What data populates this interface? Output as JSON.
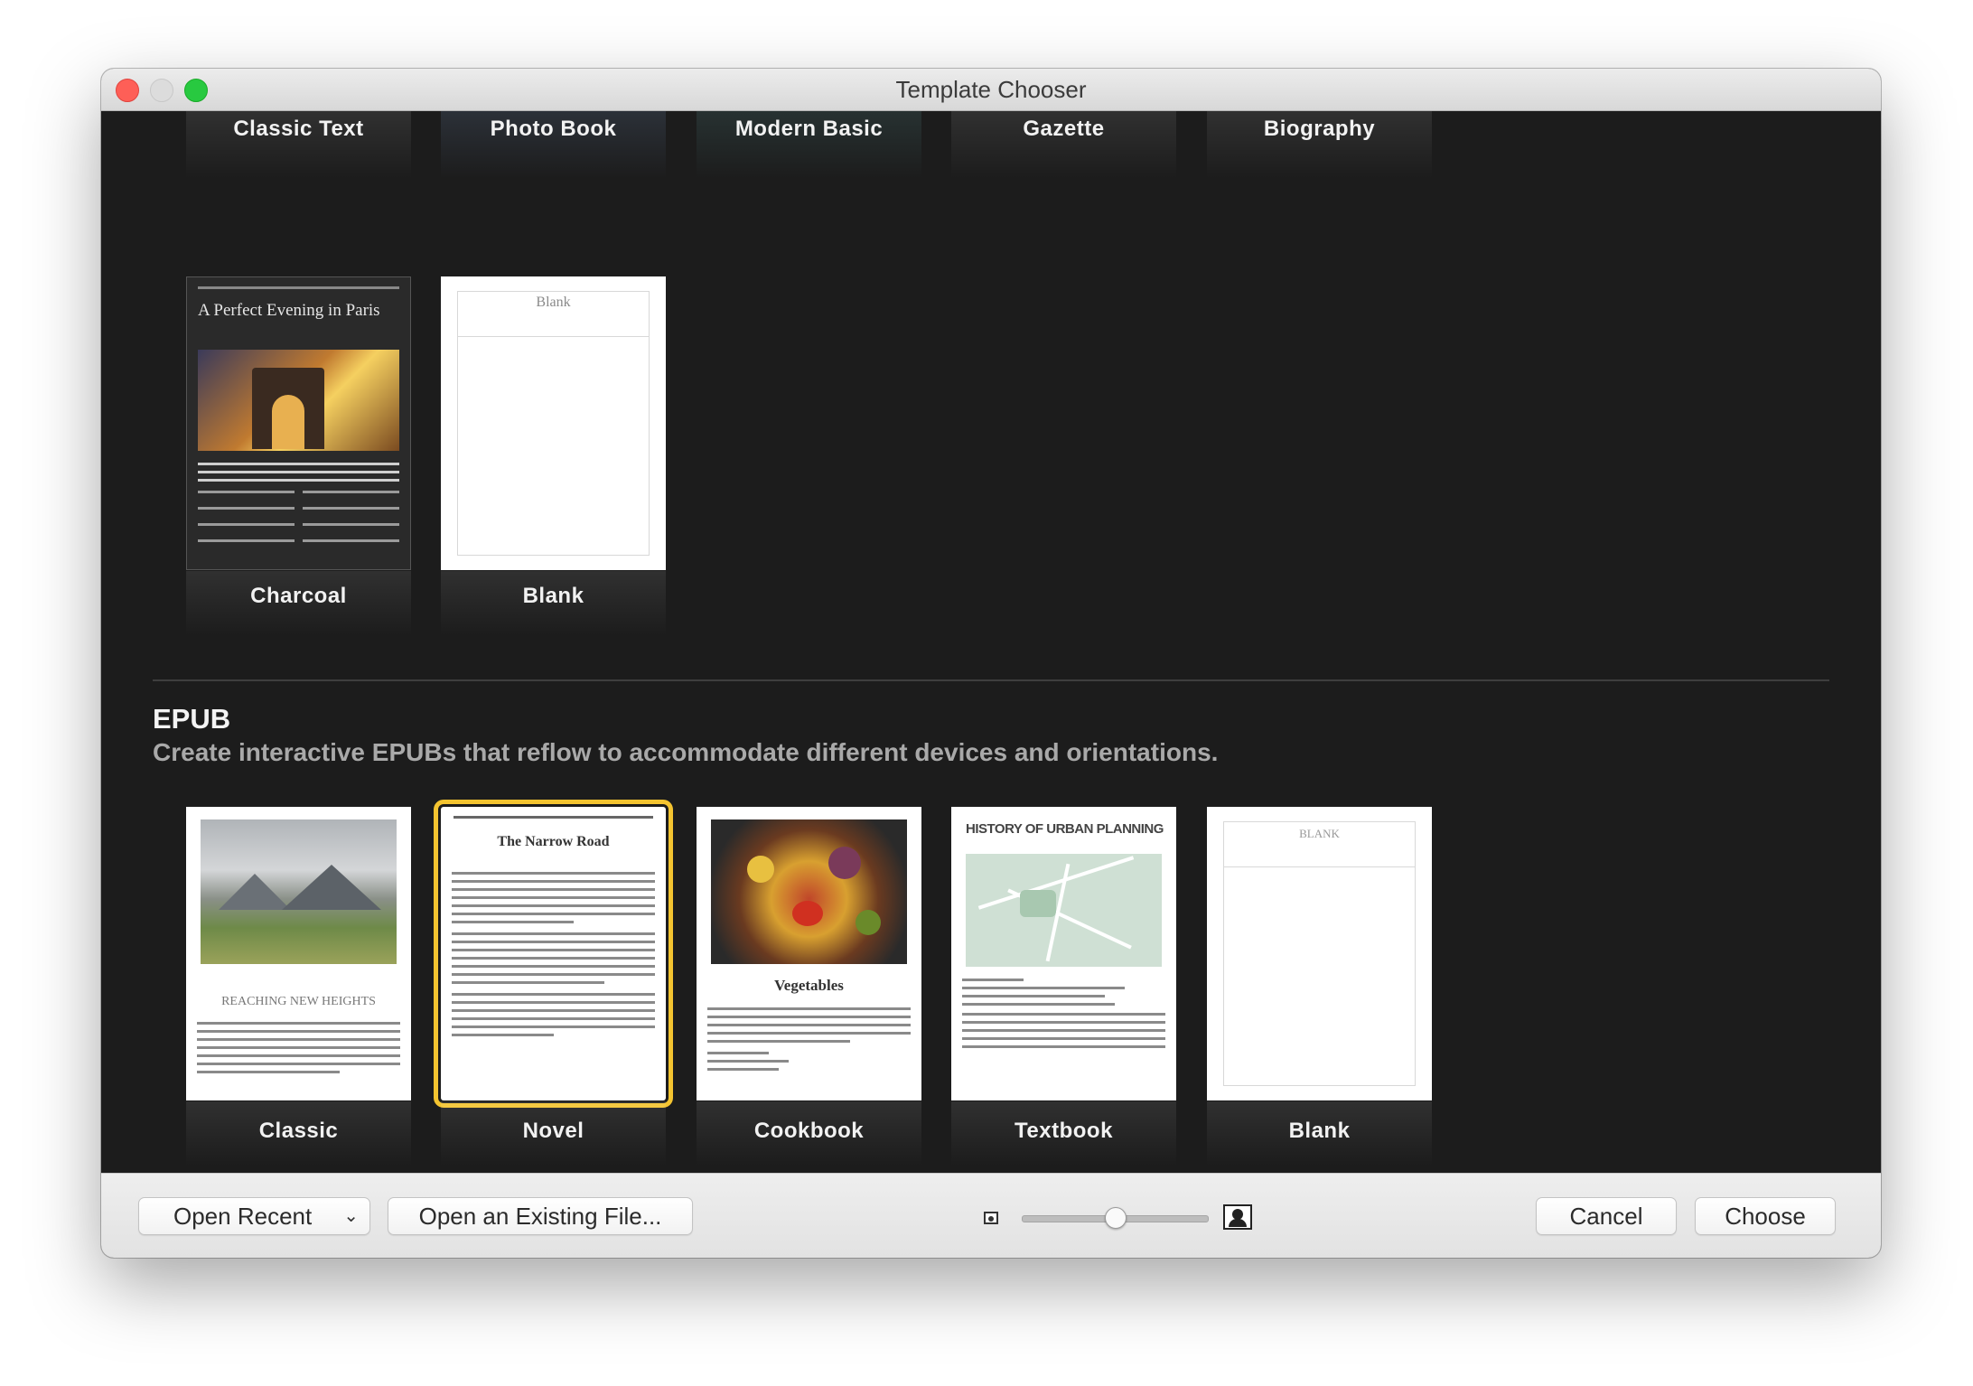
{
  "window": {
    "title": "Template Chooser"
  },
  "top_row": [
    {
      "label": "Classic Text"
    },
    {
      "label": "Photo Book"
    },
    {
      "label": "Modern Basic"
    },
    {
      "label": "Gazette"
    },
    {
      "label": "Biography"
    }
  ],
  "second_row": [
    {
      "label": "Charcoal",
      "preview_title": "A Perfect Evening in Paris"
    },
    {
      "label": "Blank",
      "preview_title": "Blank"
    }
  ],
  "epub": {
    "title": "EPUB",
    "subtitle": "Create interactive EPUBs that reflow to accommodate different devices and orientations.",
    "templates": [
      {
        "label": "Classic",
        "preview_title": "REACHING NEW HEIGHTS"
      },
      {
        "label": "Novel",
        "preview_title": "The Narrow Road",
        "selected": true
      },
      {
        "label": "Cookbook",
        "preview_title": "Vegetables"
      },
      {
        "label": "Textbook",
        "preview_title": "HISTORY OF URBAN PLANNING"
      },
      {
        "label": "Blank",
        "preview_title": "BLANK"
      }
    ]
  },
  "footer": {
    "open_recent": "Open Recent",
    "open_existing": "Open an Existing File...",
    "cancel": "Cancel",
    "choose": "Choose",
    "zoom_small_icon": "small-thumbnail-icon",
    "zoom_large_icon": "large-thumbnail-icon",
    "zoom_level": 0.5
  },
  "colors": {
    "selection": "#f4c430",
    "background": "#1c1c1c"
  }
}
